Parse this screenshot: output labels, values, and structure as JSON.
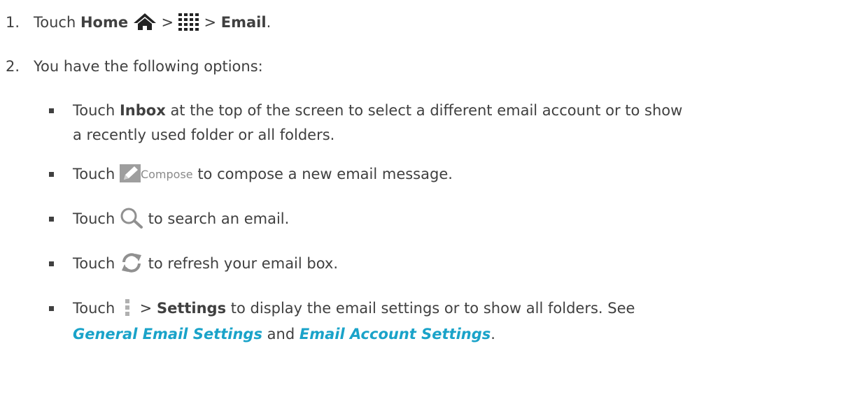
{
  "steps": [
    {
      "number": "1.",
      "touch": "Touch",
      "home": "Home",
      "sep1": ">",
      "sep2": ">",
      "email": "Email",
      "period": ".",
      "icons": [
        "home-icon",
        "apps-grid-icon"
      ]
    },
    {
      "number": "2.",
      "text": "You have the following options:"
    }
  ],
  "options": {
    "inbox": {
      "touch": "Touch",
      "bold": "Inbox",
      "rest_line1": "at the top of the screen to select a different email account or to show",
      "line2": "a recently used folder or all folders."
    },
    "compose": {
      "touch": "Touch",
      "button_label": "Compose",
      "rest": "to compose a new email message.",
      "icon": "pencil-icon"
    },
    "search": {
      "touch": "Touch",
      "rest": "to search an email.",
      "icon": "search-icon"
    },
    "refresh": {
      "touch": "Touch",
      "rest": "to refresh your email box.",
      "icon": "refresh-icon"
    },
    "settings": {
      "touch": "Touch",
      "sep": ">",
      "bold": "Settings",
      "rest_line1": "to display the email settings or to show all folders. See",
      "link1": "General Email Settings",
      "and": "and",
      "link2": "Email Account Settings",
      "period": ".",
      "icon": "overflow-menu-icon"
    }
  },
  "colors": {
    "text": "#404040",
    "link": "#1aa3c9",
    "icon": "#909090"
  }
}
